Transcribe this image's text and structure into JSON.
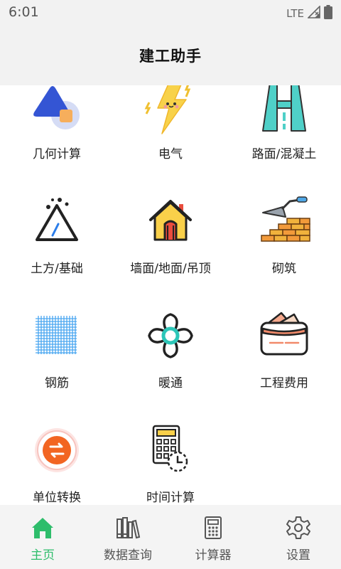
{
  "status_bar": {
    "time": "6:01",
    "network": "LTE"
  },
  "app_bar": {
    "title": "建工助手"
  },
  "grid": {
    "items": [
      {
        "label": "几何计算",
        "icon": "geometry-shapes-icon"
      },
      {
        "label": "电气",
        "icon": "lightning-bolt-icon"
      },
      {
        "label": "路面/混凝土",
        "icon": "road-icon"
      },
      {
        "label": "土方/基础",
        "icon": "earthwork-triangle-icon"
      },
      {
        "label": "墙面/地面/吊顶",
        "icon": "house-icon"
      },
      {
        "label": "砌筑",
        "icon": "brick-wall-trowel-icon"
      },
      {
        "label": "钢筋",
        "icon": "rebar-mesh-icon"
      },
      {
        "label": "暖通",
        "icon": "fan-icon"
      },
      {
        "label": "工程费用",
        "icon": "wallet-icon"
      },
      {
        "label": "单位转换",
        "icon": "unit-convert-icon"
      },
      {
        "label": "时间计算",
        "icon": "calculator-clock-icon"
      }
    ]
  },
  "bottom_nav": {
    "items": [
      {
        "label": "主页",
        "icon": "home-icon",
        "active": true
      },
      {
        "label": "数据查询",
        "icon": "books-icon",
        "active": false
      },
      {
        "label": "计算器",
        "icon": "calculator-icon",
        "active": false
      },
      {
        "label": "设置",
        "icon": "gear-icon",
        "active": false
      }
    ]
  },
  "colors": {
    "accent": "#2ebd6b",
    "bar_background": "#f2f2f2",
    "nav_background": "#f4f4f4"
  }
}
